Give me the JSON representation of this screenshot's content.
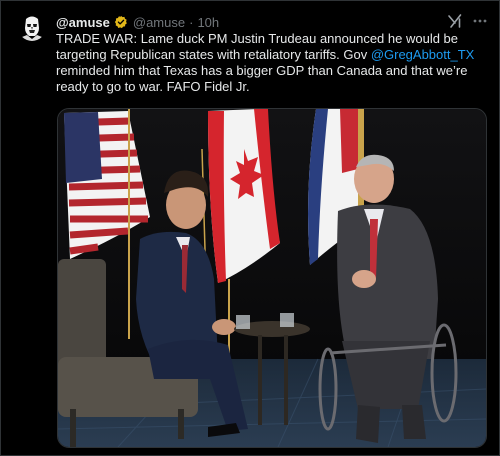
{
  "post": {
    "display_name": "@amuse",
    "handle": "@amuse",
    "separator": "·",
    "time": "10h",
    "text_prefix": "TRADE WAR: Lame duck PM Justin Trudeau announced he would be targeting Republican states with retaliatory tariffs. Gov ",
    "mention": "@GregAbbott_TX",
    "text_suffix": " reminded him that Texas has a bigger GDP than Canada and that we’re ready to go to war. FAFO Fidel Jr."
  },
  "icons": {
    "avatar": "stormtrooper-avatar-icon",
    "verified": "verified-badge-icon",
    "grok": "grok-icon",
    "more": "more-icon"
  },
  "colors": {
    "background": "#000000",
    "text": "#e7e9ea",
    "muted": "#71767b",
    "link": "#1d9bf0",
    "verified_gold": "#e2b719"
  },
  "media": {
    "alt": "Photo of Justin Trudeau and Greg Abbott seated in front of US, Canadian and Texas flags"
  }
}
